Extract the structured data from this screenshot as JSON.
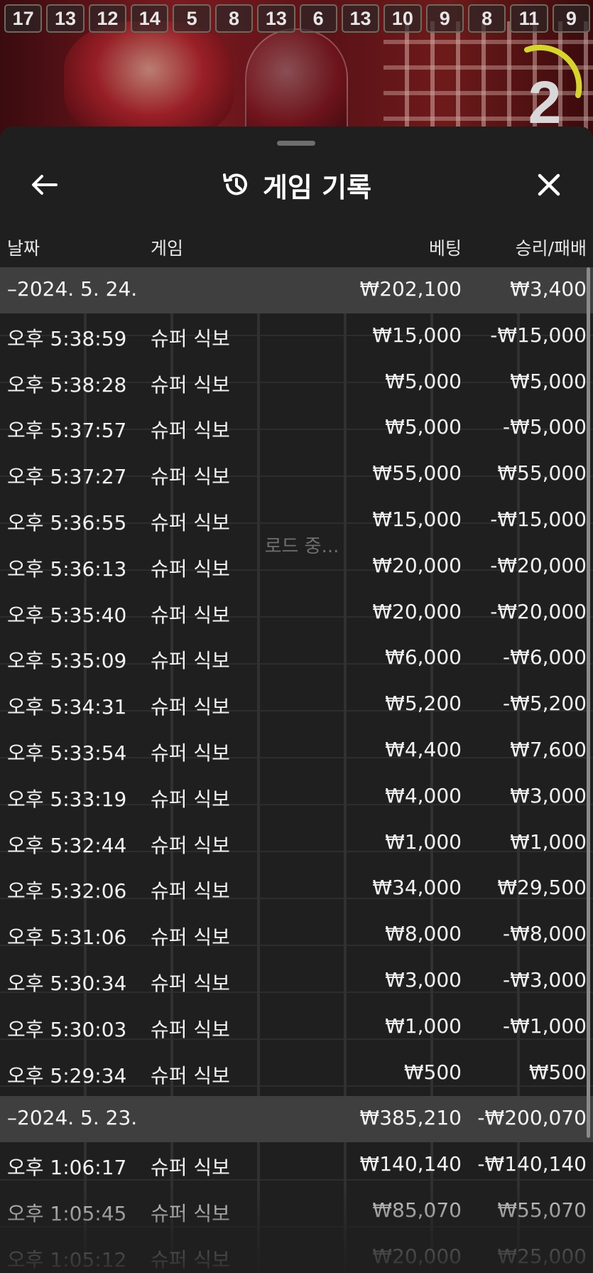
{
  "road_numbers": [
    "17",
    "13",
    "12",
    "14",
    "5",
    "8",
    "13",
    "6",
    "13",
    "10",
    "9",
    "8",
    "11",
    "9"
  ],
  "timer": {
    "value": "2",
    "arc_fraction": 0.25,
    "arc_color": "#d6d62a"
  },
  "sheet": {
    "title": "게임 기록",
    "history_icon": "history-icon",
    "back_icon": "arrow-left-icon",
    "close_icon": "close-icon"
  },
  "columns": {
    "date": "날짜",
    "game": "게임",
    "bet": "베팅",
    "winloss": "승리/패배"
  },
  "loading_text": "로드 중...",
  "groups": [
    {
      "date": "–2024. 5. 24.",
      "total_bet": "₩202,100",
      "total_winloss": "₩3,400",
      "rows": [
        {
          "time": "오후 5:38:59",
          "game": "슈퍼 식보",
          "bet": "₩15,000",
          "winloss": "-₩15,000"
        },
        {
          "time": "오후 5:38:28",
          "game": "슈퍼 식보",
          "bet": "₩5,000",
          "winloss": "₩5,000"
        },
        {
          "time": "오후 5:37:57",
          "game": "슈퍼 식보",
          "bet": "₩5,000",
          "winloss": "-₩5,000"
        },
        {
          "time": "오후 5:37:27",
          "game": "슈퍼 식보",
          "bet": "₩55,000",
          "winloss": "₩55,000"
        },
        {
          "time": "오후 5:36:55",
          "game": "슈퍼 식보",
          "bet": "₩15,000",
          "winloss": "-₩15,000"
        },
        {
          "time": "오후 5:36:13",
          "game": "슈퍼 식보",
          "bet": "₩20,000",
          "winloss": "-₩20,000"
        },
        {
          "time": "오후 5:35:40",
          "game": "슈퍼 식보",
          "bet": "₩20,000",
          "winloss": "-₩20,000"
        },
        {
          "time": "오후 5:35:09",
          "game": "슈퍼 식보",
          "bet": "₩6,000",
          "winloss": "-₩6,000"
        },
        {
          "time": "오후 5:34:31",
          "game": "슈퍼 식보",
          "bet": "₩5,200",
          "winloss": "-₩5,200"
        },
        {
          "time": "오후 5:33:54",
          "game": "슈퍼 식보",
          "bet": "₩4,400",
          "winloss": "₩7,600"
        },
        {
          "time": "오후 5:33:19",
          "game": "슈퍼 식보",
          "bet": "₩4,000",
          "winloss": "₩3,000"
        },
        {
          "time": "오후 5:32:44",
          "game": "슈퍼 식보",
          "bet": "₩1,000",
          "winloss": "₩1,000"
        },
        {
          "time": "오후 5:32:06",
          "game": "슈퍼 식보",
          "bet": "₩34,000",
          "winloss": "₩29,500"
        },
        {
          "time": "오후 5:31:06",
          "game": "슈퍼 식보",
          "bet": "₩8,000",
          "winloss": "-₩8,000"
        },
        {
          "time": "오후 5:30:34",
          "game": "슈퍼 식보",
          "bet": "₩3,000",
          "winloss": "-₩3,000"
        },
        {
          "time": "오후 5:30:03",
          "game": "슈퍼 식보",
          "bet": "₩1,000",
          "winloss": "-₩1,000"
        },
        {
          "time": "오후 5:29:34",
          "game": "슈퍼 식보",
          "bet": "₩500",
          "winloss": "₩500"
        }
      ]
    },
    {
      "date": "–2024. 5. 23.",
      "total_bet": "₩385,210",
      "total_winloss": "-₩200,070",
      "rows": [
        {
          "time": "오후 1:06:17",
          "game": "슈퍼 식보",
          "bet": "₩140,140",
          "winloss": "-₩140,140"
        },
        {
          "time": "오후 1:05:45",
          "game": "슈퍼 식보",
          "bet": "₩85,070",
          "winloss": "₩55,070"
        },
        {
          "time": "오후 1:05:12",
          "game": "슈퍼 식보",
          "bet": "₩20,000",
          "winloss": "₩25,000"
        }
      ]
    }
  ]
}
